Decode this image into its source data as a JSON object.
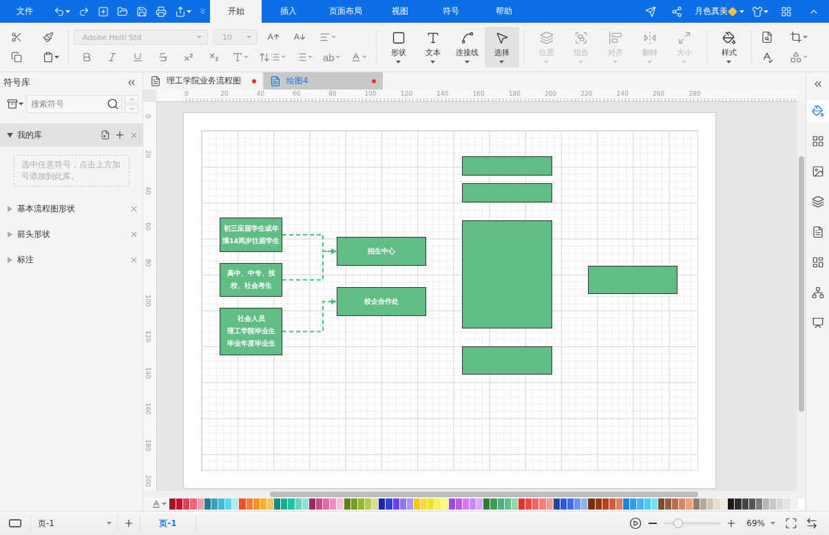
{
  "menu_bar": {
    "file": "文件",
    "tabs": [
      {
        "label": "开始",
        "selected": true
      },
      {
        "label": "插入",
        "selected": false
      },
      {
        "label": "页面布局",
        "selected": false
      },
      {
        "label": "视图",
        "selected": false
      },
      {
        "label": "符号",
        "selected": false
      },
      {
        "label": "帮助",
        "selected": false
      }
    ],
    "user": "月色真美"
  },
  "ribbon": {
    "font": "Adobe Heiti Std",
    "size": "10",
    "highlight": "ab",
    "tools": [
      {
        "label": "形状",
        "selected": false,
        "disabled": false
      },
      {
        "label": "文本",
        "selected": false,
        "disabled": false
      },
      {
        "label": "连接线",
        "selected": false,
        "disabled": false
      },
      {
        "label": "选择",
        "selected": true,
        "disabled": false
      },
      {
        "label": "位置",
        "selected": false,
        "disabled": true
      },
      {
        "label": "组合",
        "selected": false,
        "disabled": true
      },
      {
        "label": "对齐",
        "selected": false,
        "disabled": true
      },
      {
        "label": "翻转",
        "selected": false,
        "disabled": true
      },
      {
        "label": "大小",
        "selected": false,
        "disabled": true
      },
      {
        "label": "样式",
        "selected": false,
        "disabled": false
      }
    ]
  },
  "symbol_library": {
    "title": "符号库",
    "search": {
      "placeholder": "搜索符号"
    },
    "my_library": {
      "label": "我的库",
      "expanded": true,
      "hint": "选中任意符号，点击上方加号添加到此库。"
    },
    "sections": [
      {
        "label": "基本流程图形状",
        "expanded": false
      },
      {
        "label": "箭头形状",
        "expanded": false
      },
      {
        "label": "标注",
        "expanded": false
      }
    ]
  },
  "document_tabs": [
    {
      "title": "理工学院业务流程图",
      "selected": false,
      "modified": true
    },
    {
      "title": "绘图4",
      "selected": true,
      "modified": true
    }
  ],
  "ruler": {
    "x_labels": [
      "0",
      "20",
      "40",
      "60",
      "80",
      "100",
      "120",
      "140",
      "160",
      "180",
      "200",
      "220",
      "240",
      "260",
      "280"
    ],
    "y_labels": [
      "0",
      "20",
      "40",
      "60",
      "80",
      "100",
      "120",
      "140",
      "160",
      "180",
      "200"
    ]
  },
  "diagram": {
    "nodes": [
      {
        "kind": "box",
        "lines": [
          "初三应届学生或年",
          "满14周岁往届学生"
        ]
      },
      {
        "kind": "box",
        "lines": [
          "高中、中专、技",
          "校、社会考生"
        ]
      },
      {
        "kind": "box",
        "lines": [
          "社会人员",
          "理工学院毕业生",
          "毕业年度毕业生"
        ]
      },
      {
        "kind": "box",
        "lines": [
          "招生中心"
        ]
      },
      {
        "kind": "box",
        "lines": [
          "校企合作处"
        ]
      },
      {
        "kind": "box"
      },
      {
        "kind": "box"
      },
      {
        "kind": "box"
      },
      {
        "kind": "box"
      },
      {
        "kind": "box"
      }
    ],
    "connectors": [
      {
        "kind": "dashed-arrow"
      },
      {
        "kind": "dashed-arrow"
      },
      {
        "kind": "dashed-arrow"
      }
    ]
  },
  "palette": [
    {
      "color": "#a31621"
    },
    {
      "color": "#c8102e"
    },
    {
      "color": "#e63e5c"
    },
    {
      "color": "#f2647a"
    },
    {
      "color": "#f49bab"
    },
    {
      "color": "#237a8f"
    },
    {
      "color": "#33a3bf"
    },
    {
      "color": "#3dbad8"
    },
    {
      "color": "#5dd6ec"
    },
    {
      "color": "#a9ecf7"
    },
    {
      "color": "#f05023"
    },
    {
      "color": "#fb7c36"
    },
    {
      "color": "#fd9321"
    },
    {
      "color": "#fdb515"
    },
    {
      "color": "#fec35a"
    },
    {
      "color": "#128c7e"
    },
    {
      "color": "#16ad96"
    },
    {
      "color": "#18c4a6"
    },
    {
      "color": "#66d2bd"
    },
    {
      "color": "#8de4d3"
    },
    {
      "color": "#9b2c5a"
    },
    {
      "color": "#c9488c"
    },
    {
      "color": "#e467a8"
    },
    {
      "color": "#f38cc6"
    },
    {
      "color": "#f2c2dc"
    },
    {
      "color": "#5c8415"
    },
    {
      "color": "#72a126"
    },
    {
      "color": "#98b81f"
    },
    {
      "color": "#b1ce45"
    },
    {
      "color": "#d2e08f"
    },
    {
      "color": "#20289f"
    },
    {
      "color": "#3040d8"
    },
    {
      "color": "#6a42f0"
    },
    {
      "color": "#8d74f4"
    },
    {
      "color": "#ab95f7"
    },
    {
      "color": "#f9c80e"
    },
    {
      "color": "#fddd33"
    },
    {
      "color": "#f0e42a"
    },
    {
      "color": "#faf251"
    },
    {
      "color": "#fafa85"
    },
    {
      "color": "#9b4dde"
    },
    {
      "color": "#c354e6"
    },
    {
      "color": "#d775f5"
    },
    {
      "color": "#c58af9"
    },
    {
      "color": "#dda6fb"
    },
    {
      "color": "#2c7a3c"
    },
    {
      "color": "#3a9d51"
    },
    {
      "color": "#4fb07a"
    },
    {
      "color": "#61bd87"
    },
    {
      "color": "#93d8aa"
    },
    {
      "color": "#e0342b"
    },
    {
      "color": "#f4473d"
    },
    {
      "color": "#f76262"
    },
    {
      "color": "#fb7c7c"
    },
    {
      "color": "#fc9a8f"
    },
    {
      "color": "#22439e"
    },
    {
      "color": "#2d5ad0"
    },
    {
      "color": "#3a6cf0"
    },
    {
      "color": "#6a91fc"
    },
    {
      "color": "#90b0f6"
    },
    {
      "color": "#782d0b"
    },
    {
      "color": "#983a10"
    },
    {
      "color": "#ae4424"
    },
    {
      "color": "#cc5c3a"
    },
    {
      "color": "#e47b5b"
    },
    {
      "color": "#1687d8"
    },
    {
      "color": "#2b9ef0"
    },
    {
      "color": "#4cb3f8"
    },
    {
      "color": "#41cff8"
    },
    {
      "color": "#6ae3fd"
    },
    {
      "color": "#7a4a33"
    },
    {
      "color": "#955c3e"
    },
    {
      "color": "#b1714f"
    },
    {
      "color": "#d48964"
    },
    {
      "color": "#f29f71"
    },
    {
      "color": "#8a7e74"
    },
    {
      "color": "#b0ab9a"
    },
    {
      "color": "#cdc8b8"
    },
    {
      "color": "#e3ddcc"
    },
    {
      "color": "#f0ebd9"
    },
    {
      "color": "#1a1a1a"
    },
    {
      "color": "#2e2e2e"
    },
    {
      "color": "#444444"
    },
    {
      "color": "#555555"
    },
    {
      "color": "#7a7a7a"
    },
    {
      "color": "#b8b8b8"
    },
    {
      "color": "#c8c8c8"
    },
    {
      "color": "#d8d8d8"
    },
    {
      "color": "#e5e5e5"
    },
    {
      "color": "#f0f0f0"
    },
    {
      "color": "#ffffff"
    }
  ],
  "status_bar": {
    "page_select": "页-1",
    "pages": [
      {
        "label": "页-1",
        "selected": true
      }
    ],
    "zoom": {
      "level": 0.25,
      "reading": "69%"
    }
  }
}
